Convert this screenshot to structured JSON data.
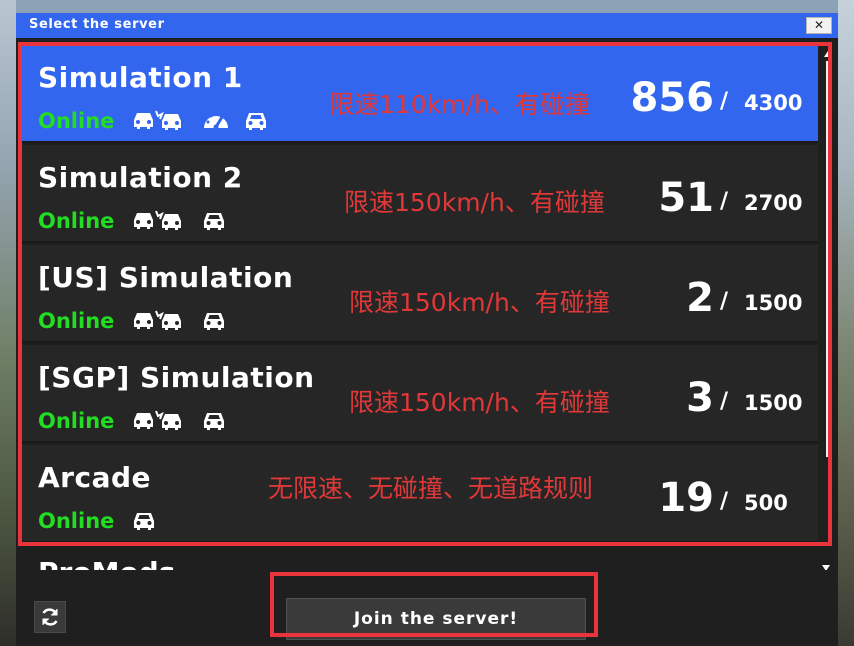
{
  "window": {
    "title": "Select the server",
    "close_label": "✕"
  },
  "servers": [
    {
      "name": "Simulation  1",
      "status": "Online",
      "note": "限速110km/h、有碰撞",
      "players": "856",
      "max": "4300",
      "icons": [
        "car-collision-icon",
        "speed-limit-icon",
        "car-icon"
      ]
    },
    {
      "name": "Simulation  2",
      "status": "Online",
      "note": "限速150km/h、有碰撞",
      "players": "51",
      "max": "2700",
      "icons": [
        "car-collision-icon",
        "car-icon"
      ]
    },
    {
      "name": "[US]  Simulation",
      "status": "Online",
      "note": "限速150km/h、有碰撞",
      "players": "2",
      "max": "1500",
      "icons": [
        "car-collision-icon",
        "car-icon"
      ]
    },
    {
      "name": "[SGP]  Simulation",
      "status": "Online",
      "note": "限速150km/h、有碰撞",
      "players": "3",
      "max": "1500",
      "icons": [
        "car-collision-icon",
        "car-icon"
      ]
    },
    {
      "name": "Arcade",
      "status": "Online",
      "note": "无限速、无碰撞、无道路规则",
      "players": "19",
      "max": "500",
      "icons": [
        "car-icon"
      ]
    }
  ],
  "partial_server": {
    "name": "ProMods"
  },
  "slash": "/",
  "footer": {
    "join_label": "Join the server!",
    "refresh_icon": "refresh-icon"
  },
  "colors": {
    "accent": "#3366ee",
    "online": "#22dd22",
    "annotation": "#e8343a"
  }
}
